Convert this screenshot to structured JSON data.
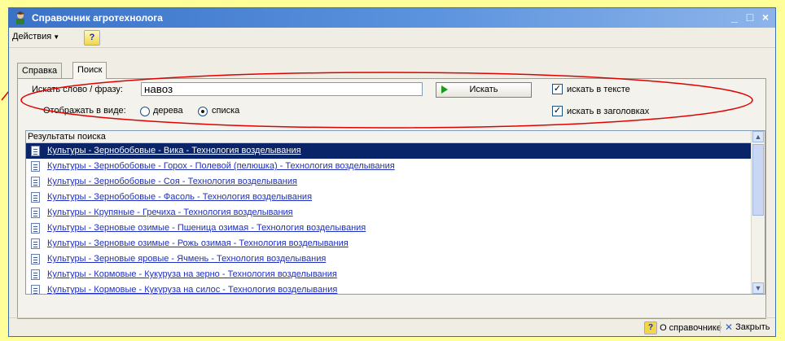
{
  "window": {
    "title": "Справочник агротехнолога",
    "controls": {
      "minimize": "_",
      "maximize": "□",
      "close": "×"
    }
  },
  "menubar": {
    "actions_label": "Действия",
    "help_label": "?"
  },
  "tabs": [
    {
      "label": "Справка",
      "active": false
    },
    {
      "label": "Поиск",
      "active": true
    }
  ],
  "search": {
    "label": "Искать слово / фразу:",
    "value": "навоз",
    "button_label": "Искать",
    "display_label": "Отображать в виде:",
    "view_options": [
      {
        "label": "дерева",
        "selected": false
      },
      {
        "label": "списка",
        "selected": true
      }
    ],
    "checkbox_text": {
      "label": "искать в тексте",
      "checked": true
    },
    "checkbox_titles": {
      "label": "искать в заголовках",
      "checked": true
    }
  },
  "results": {
    "header": "Результаты поиска",
    "items": [
      "Культуры - Зернобобовые - Вика - Технология возделывания",
      "Культуры - Зернобобовые - Горох - Полевой (пелюшка) - Технология возделывания",
      "Культуры - Зернобобовые - Соя - Технология возделывания",
      "Культуры - Зернобобовые - Фасоль - Технология возделывания",
      "Культуры - Крупяные - Гречиха - Технология возделывания",
      "Культуры - Зерновые озимые - Пшеница озимая - Технология возделывания",
      "Культуры - Зерновые озимые - Рожь озимая - Технология возделывания",
      "Культуры - Зерновые яровые - Ячмень - Технология возделывания",
      "Культуры - Кормовые - Кукуруза на зерно - Технология возделывания",
      "Культуры - Кормовые - Кукуруза на силос - Технология возделывания"
    ],
    "selected_index": 0
  },
  "statusbar": {
    "about_label": "О справочнике",
    "close_label": "Закрыть"
  },
  "colors": {
    "background": "#ffff9a",
    "annotation": "#e00000",
    "selection": "#0a246a",
    "link": "#1f2fbd"
  }
}
